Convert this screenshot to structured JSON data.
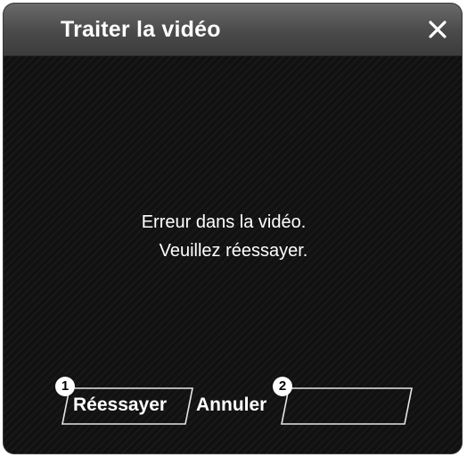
{
  "dialog": {
    "title": "Traiter la vidéo",
    "close_icon": "close-icon",
    "message_line1": "Erreur dans la vidéo.",
    "message_line2": "Veuillez réessayer."
  },
  "buttons": {
    "retry": {
      "label": "Réessayer",
      "badge": "1"
    },
    "cancel": {
      "label": "Annuler",
      "badge": "2"
    }
  },
  "colors": {
    "titlebar": "#4a4a4a",
    "background": "#121212",
    "text": "#ffffff"
  }
}
